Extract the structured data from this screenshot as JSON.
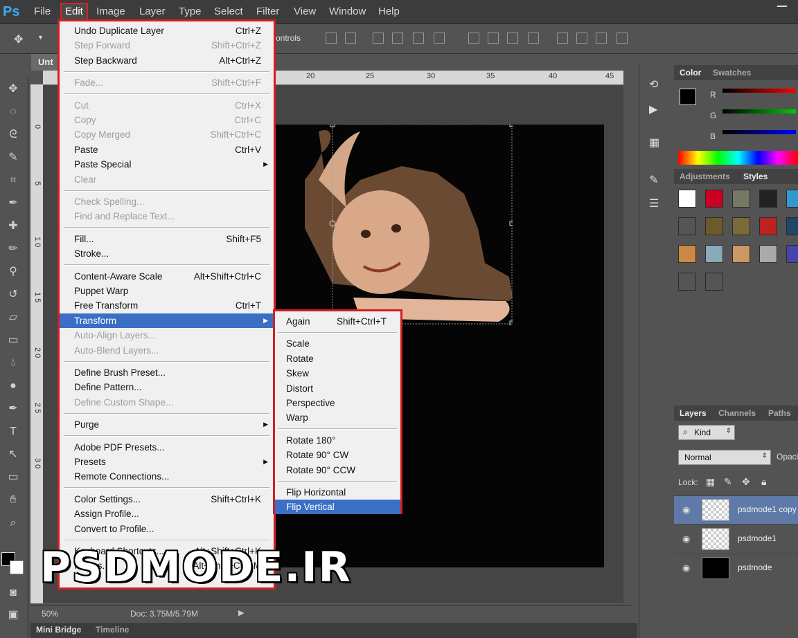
{
  "app": {
    "logo": "Ps"
  },
  "menubar": {
    "items": [
      "File",
      "Edit",
      "Image",
      "Layer",
      "Type",
      "Select",
      "Filter",
      "View",
      "Window",
      "Help"
    ]
  },
  "options": {
    "controls_label": "ontrols"
  },
  "document": {
    "tab_title": "Unt",
    "ruler_ticks": [
      "20",
      "25",
      "30",
      "35",
      "40",
      "45"
    ],
    "ruler_left_ticks": [
      "0",
      "5",
      "1\n0",
      "1\n5",
      "2\n0",
      "2\n5",
      "3\n0"
    ]
  },
  "edit_menu": {
    "groups": [
      [
        {
          "label": "Undo Duplicate Layer",
          "shortcut": "Ctrl+Z",
          "disabled": false
        },
        {
          "label": "Step Forward",
          "shortcut": "Shift+Ctrl+Z",
          "disabled": true
        },
        {
          "label": "Step Backward",
          "shortcut": "Alt+Ctrl+Z",
          "disabled": false
        }
      ],
      [
        {
          "label": "Fade...",
          "shortcut": "Shift+Ctrl+F",
          "disabled": true
        }
      ],
      [
        {
          "label": "Cut",
          "shortcut": "Ctrl+X",
          "disabled": true
        },
        {
          "label": "Copy",
          "shortcut": "Ctrl+C",
          "disabled": true
        },
        {
          "label": "Copy Merged",
          "shortcut": "Shift+Ctrl+C",
          "disabled": true
        },
        {
          "label": "Paste",
          "shortcut": "Ctrl+V",
          "disabled": false
        },
        {
          "label": "Paste Special",
          "shortcut": "",
          "disabled": false,
          "submenu": true
        },
        {
          "label": "Clear",
          "shortcut": "",
          "disabled": true
        }
      ],
      [
        {
          "label": "Check Spelling...",
          "shortcut": "",
          "disabled": true
        },
        {
          "label": "Find and Replace Text...",
          "shortcut": "",
          "disabled": true
        }
      ],
      [
        {
          "label": "Fill...",
          "shortcut": "Shift+F5",
          "disabled": false
        },
        {
          "label": "Stroke...",
          "shortcut": "",
          "disabled": false
        }
      ],
      [
        {
          "label": "Content-Aware Scale",
          "shortcut": "Alt+Shift+Ctrl+C",
          "disabled": false
        },
        {
          "label": "Puppet Warp",
          "shortcut": "",
          "disabled": false
        },
        {
          "label": "Free Transform",
          "shortcut": "Ctrl+T",
          "disabled": false
        },
        {
          "label": "Transform",
          "shortcut": "",
          "disabled": false,
          "submenu": true,
          "highlighted": true
        },
        {
          "label": "Auto-Align Layers...",
          "shortcut": "",
          "disabled": true
        },
        {
          "label": "Auto-Blend Layers...",
          "shortcut": "",
          "disabled": true
        }
      ],
      [
        {
          "label": "Define Brush Preset...",
          "shortcut": "",
          "disabled": false
        },
        {
          "label": "Define Pattern...",
          "shortcut": "",
          "disabled": false
        },
        {
          "label": "Define Custom Shape...",
          "shortcut": "",
          "disabled": true
        }
      ],
      [
        {
          "label": "Purge",
          "shortcut": "",
          "disabled": false,
          "submenu": true
        }
      ],
      [
        {
          "label": "Adobe PDF Presets...",
          "shortcut": "",
          "disabled": false
        },
        {
          "label": "Presets",
          "shortcut": "",
          "disabled": false,
          "submenu": true
        },
        {
          "label": "Remote Connections...",
          "shortcut": "",
          "disabled": false
        }
      ],
      [
        {
          "label": "Color Settings...",
          "shortcut": "Shift+Ctrl+K",
          "disabled": false
        },
        {
          "label": "Assign Profile...",
          "shortcut": "",
          "disabled": false
        },
        {
          "label": "Convert to Profile...",
          "shortcut": "",
          "disabled": false
        }
      ],
      [
        {
          "label": "Keyboard Shortcuts...",
          "shortcut": "Alt+Shift+Ctrl+K",
          "disabled": false
        },
        {
          "label": "Menus...",
          "shortcut": "Alt+Shift+Ctrl+M",
          "disabled": false
        }
      ]
    ]
  },
  "transform_menu": {
    "groups": [
      [
        {
          "label": "Again",
          "shortcut": "Shift+Ctrl+T"
        }
      ],
      [
        {
          "label": "Scale"
        },
        {
          "label": "Rotate"
        },
        {
          "label": "Skew"
        },
        {
          "label": "Distort"
        },
        {
          "label": "Perspective"
        },
        {
          "label": "Warp"
        }
      ],
      [
        {
          "label": "Rotate 180°"
        },
        {
          "label": "Rotate 90° CW"
        },
        {
          "label": "Rotate 90° CCW"
        }
      ],
      [
        {
          "label": "Flip Horizontal"
        },
        {
          "label": "Flip Vertical",
          "highlighted": true
        }
      ]
    ]
  },
  "status": {
    "zoom": "50%",
    "doc": "Doc: 3.75M/5.79M"
  },
  "bottom_tabs": [
    "Mini Bridge",
    "Timeline"
  ],
  "color_panel": {
    "tabs": [
      "Color",
      "Swatches"
    ],
    "channels": [
      "R",
      "G",
      "B"
    ]
  },
  "styles_panel": {
    "tabs": [
      "Adjustments",
      "Styles"
    ]
  },
  "layers_panel": {
    "tabs": [
      "Layers",
      "Channels",
      "Paths"
    ],
    "kind_label": "Kind",
    "blend_mode": "Normal",
    "opacity_label": "Opaci",
    "lock_label": "Lock:",
    "layers": [
      {
        "name": "psdmode1 copy",
        "selected": true,
        "thumb": "photo"
      },
      {
        "name": "psdmode1",
        "selected": false,
        "thumb": "photo"
      },
      {
        "name": "psdmode",
        "selected": false,
        "thumb": "black"
      }
    ]
  },
  "watermark": {
    "text": "PSDMODE.IR"
  }
}
